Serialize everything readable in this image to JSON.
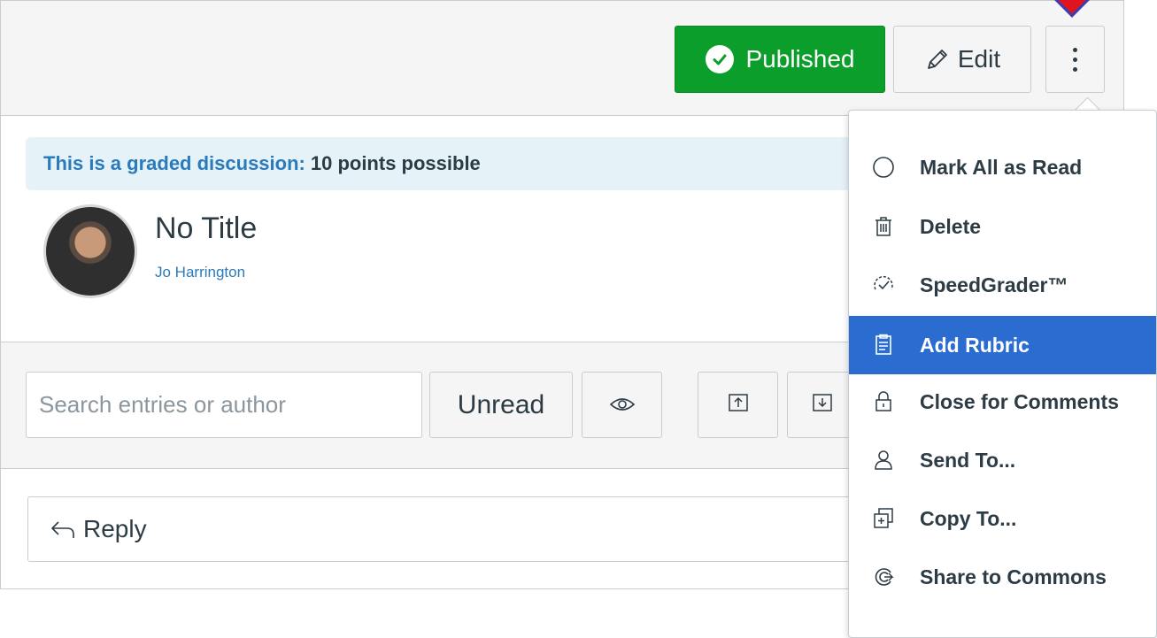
{
  "header": {
    "published_label": "Published",
    "edit_label": "Edit"
  },
  "discussion": {
    "graded_label": "This is a graded discussion:",
    "graded_points": "10 points possible",
    "title": "No Title",
    "author": "Jo Harrington"
  },
  "toolbar": {
    "search_placeholder": "Search entries or author",
    "unread_label": "Unread"
  },
  "reply": {
    "label": "Reply"
  },
  "menu": {
    "items": [
      {
        "label": "Mark All as Read",
        "icon": "circle-icon"
      },
      {
        "label": "Delete",
        "icon": "trash-icon"
      },
      {
        "label": "SpeedGrader™",
        "icon": "speedgrader-icon"
      },
      {
        "label": "Add Rubric",
        "icon": "rubric-icon",
        "active": true
      },
      {
        "label": "Close for Comments",
        "icon": "lock-icon"
      },
      {
        "label": "Send To...",
        "icon": "user-icon"
      },
      {
        "label": "Copy To...",
        "icon": "copy-icon"
      },
      {
        "label": "Share to Commons",
        "icon": "commons-icon"
      }
    ]
  },
  "colors": {
    "published_green": "#0b9e2b",
    "link_blue": "#2b7abc",
    "active_blue": "#2b6cd1",
    "banner_bg": "#e5f2f8"
  }
}
